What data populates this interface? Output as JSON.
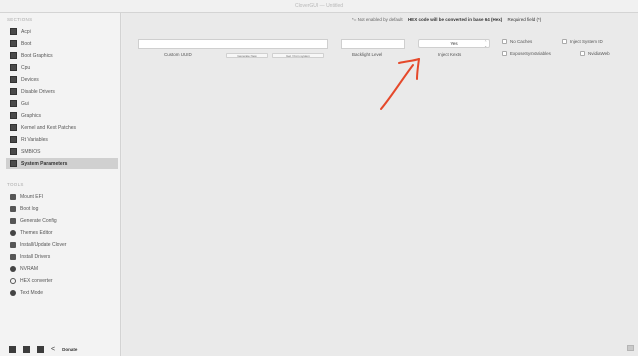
{
  "window": {
    "title": "CloverGUI — Untitled"
  },
  "sidebar": {
    "sections_header": "SECTIONS",
    "sections": [
      {
        "label": "Acpi",
        "icon": "acpi-icon"
      },
      {
        "label": "Boot",
        "icon": "boot-icon"
      },
      {
        "label": "Boot Graphics",
        "icon": "boot-graphics-icon"
      },
      {
        "label": "Cpu",
        "icon": "cpu-icon"
      },
      {
        "label": "Devices",
        "icon": "devices-icon"
      },
      {
        "label": "Disable Drivers",
        "icon": "disable-drivers-icon"
      },
      {
        "label": "Gui",
        "icon": "gui-icon"
      },
      {
        "label": "Graphics",
        "icon": "graphics-icon"
      },
      {
        "label": "Kernel and Kext Patches",
        "icon": "kernel-kext-patches-icon"
      },
      {
        "label": "Rt Variables",
        "icon": "rt-variables-icon"
      },
      {
        "label": "SMBIOS",
        "icon": "smbios-icon"
      },
      {
        "label": "System Parameters",
        "icon": "system-parameters-icon",
        "selected": true
      }
    ],
    "tools_header": "TOOLS",
    "tools": [
      {
        "label": "Mount EFI",
        "icon": "mount-efi-icon"
      },
      {
        "label": "Boot log",
        "icon": "boot-log-icon"
      },
      {
        "label": "Generate Config",
        "icon": "generate-config-icon"
      },
      {
        "label": "Themes Editor",
        "icon": "themes-editor-icon"
      },
      {
        "label": "Install/Update Clover",
        "icon": "install-clover-icon"
      },
      {
        "label": "Install Drivers",
        "icon": "install-drivers-icon"
      },
      {
        "label": "NVRAM",
        "icon": "nvram-icon"
      },
      {
        "label": "HEX converter",
        "icon": "hex-converter-icon"
      },
      {
        "label": "Text Mode",
        "icon": "text-mode-icon"
      }
    ],
    "bottom": {
      "donate_label": "Donate"
    }
  },
  "main": {
    "hint": {
      "not_enabled": "*= Not enabled by default",
      "hex_note": "HEX code will be converted in base 64 (Hex)",
      "required": "Required field (*)"
    },
    "custom_uuid": {
      "value": "",
      "label": "Custom UUID",
      "btn_generate": "Generate New",
      "btn_from_system": "Get / from system"
    },
    "backlight_level": {
      "value": "",
      "label": "Backlight Level"
    },
    "inject_kexts": {
      "value": "Yes",
      "label": "Inject Kexts"
    },
    "checkboxes": {
      "no_caches": "No Caches",
      "inject_system_id": "Inject System ID",
      "expose_sys_variables": "ExposeSysVariables",
      "nvidia_web": "NvidiaWeb"
    }
  },
  "colors": {
    "annotation_arrow": "#e5492b",
    "selected_row": "#d0d0d0"
  }
}
